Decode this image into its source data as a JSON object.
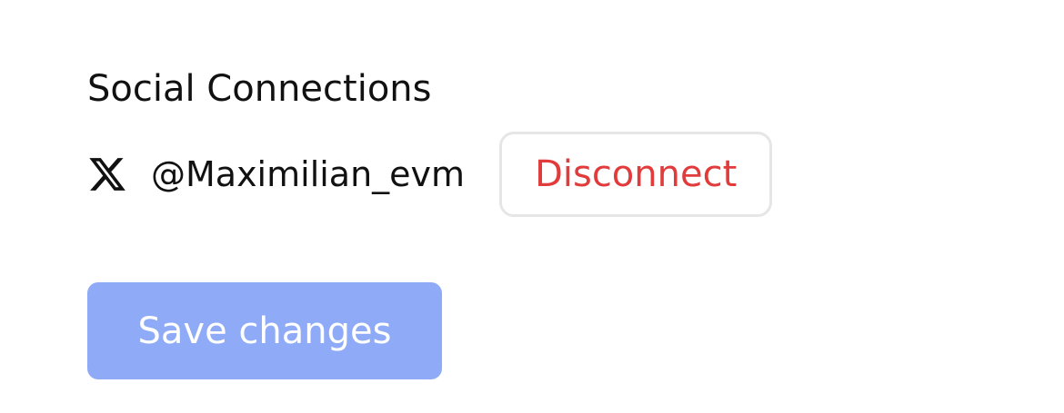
{
  "social": {
    "title": "Social Connections",
    "connections": [
      {
        "platform_icon": "x-logo-icon",
        "handle": "@Maximilian_evm",
        "action_label": "Disconnect",
        "action_color": "#e23b3b"
      }
    ]
  },
  "form": {
    "save_label": "Save changes",
    "save_color": "#8fabf7"
  }
}
